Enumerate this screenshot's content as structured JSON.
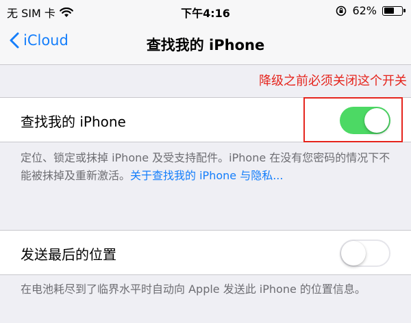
{
  "status_bar": {
    "carrier": "无 SIM 卡",
    "time": "下午4:16",
    "battery_percent": "62%",
    "battery_level": 0.62
  },
  "nav": {
    "back_label": "iCloud",
    "title": "查找我的 iPhone"
  },
  "annotation": "降级之前必须关闭这个开关",
  "find_my_iphone": {
    "label": "查找我的 iPhone",
    "enabled": true,
    "footnote": "定位、锁定或抹掉 iPhone 及受支持配件。iPhone 在没有您密码的情况下不能被抹掉及重新激活。",
    "link": "关于查找我的 iPhone 与隐私..."
  },
  "send_last_location": {
    "label": "发送最后的位置",
    "enabled": false,
    "footnote": "在电池耗尽到了临界水平时自动向 Apple 发送此 iPhone 的位置信息。"
  },
  "colors": {
    "accent": "#147efb",
    "toggle_on": "#4cd964",
    "annotation": "#e5231b"
  }
}
